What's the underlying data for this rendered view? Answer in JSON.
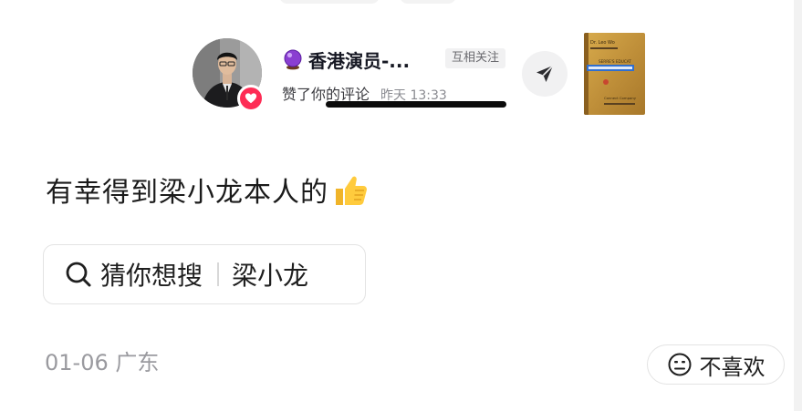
{
  "notification": {
    "user_name": "香港演员-...",
    "badge_icon": "crystal-ball-icon",
    "mutual_tag": "互相关注",
    "action": "赞了你的评论",
    "time": "昨天 13:33",
    "reaction_icon": "heart-icon",
    "send_icon": "share-arrow-icon",
    "thumbnail": {
      "line1": "Dr. Leo Wo",
      "line2": "SERRE'S EDUCAT",
      "line3": "Connect Company"
    }
  },
  "comment": {
    "text": "有幸得到梁小龙本人的",
    "emoji": "thumbs-up-icon"
  },
  "search_suggestion": {
    "label": "猜你想搜",
    "term": "梁小龙",
    "icon": "search-icon"
  },
  "meta": {
    "date_location": "01-06 广东"
  },
  "dislike": {
    "label": "不喜欢",
    "icon": "meh-face-icon"
  },
  "colors": {
    "heart_badge": "#fe2c55",
    "muted_text": "#9a9a9f",
    "thumbnail_gold": "#c79a3c"
  }
}
